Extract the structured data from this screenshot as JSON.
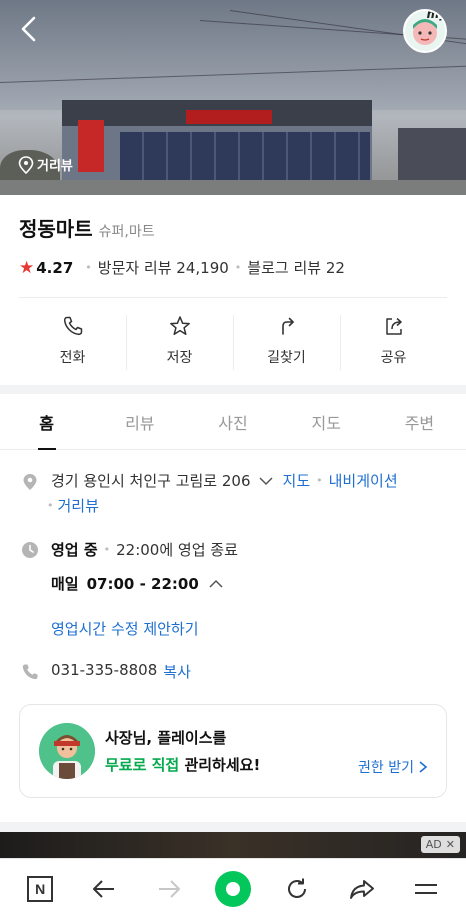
{
  "hero": {
    "street_view_label": "거리뷰",
    "avatar_badge": "my"
  },
  "place": {
    "name": "정동마트",
    "category": "슈퍼,마트",
    "rating": "4.27",
    "visitor_reviews": "방문자 리뷰 24,190",
    "blog_reviews": "블로그 리뷰 22"
  },
  "actions": [
    {
      "label": "전화",
      "icon": "phone-icon"
    },
    {
      "label": "저장",
      "icon": "star-icon"
    },
    {
      "label": "길찾기",
      "icon": "directions-icon"
    },
    {
      "label": "공유",
      "icon": "share-icon"
    }
  ],
  "tabs": [
    {
      "label": "홈",
      "active": true
    },
    {
      "label": "리뷰",
      "active": false
    },
    {
      "label": "사진",
      "active": false
    },
    {
      "label": "지도",
      "active": false
    },
    {
      "label": "주변",
      "active": false
    }
  ],
  "info": {
    "address": "경기 용인시 처인구 고림로 206",
    "map_link": "지도",
    "navigation_link": "내비게이션",
    "street_view_link": "거리뷰",
    "status": "영업 중",
    "close_time": "22:00에 영업 종료",
    "schedule_day": "매일",
    "schedule_hours": "07:00 - 22:00",
    "suggest_hours": "영업시간 수정 제안하기",
    "phone": "031-335-8808",
    "copy_label": "복사"
  },
  "owner_card": {
    "line1": "사장님, 플레이스를",
    "highlight": "무료로 직접",
    "line2_rest": " 관리하세요!",
    "cta": "권한 받기"
  },
  "ad": {
    "badge": "AD",
    "close": "✕"
  },
  "colors": {
    "accent_green": "#03c75a",
    "link_blue": "#1f6fd1",
    "star_red": "#e53935"
  }
}
